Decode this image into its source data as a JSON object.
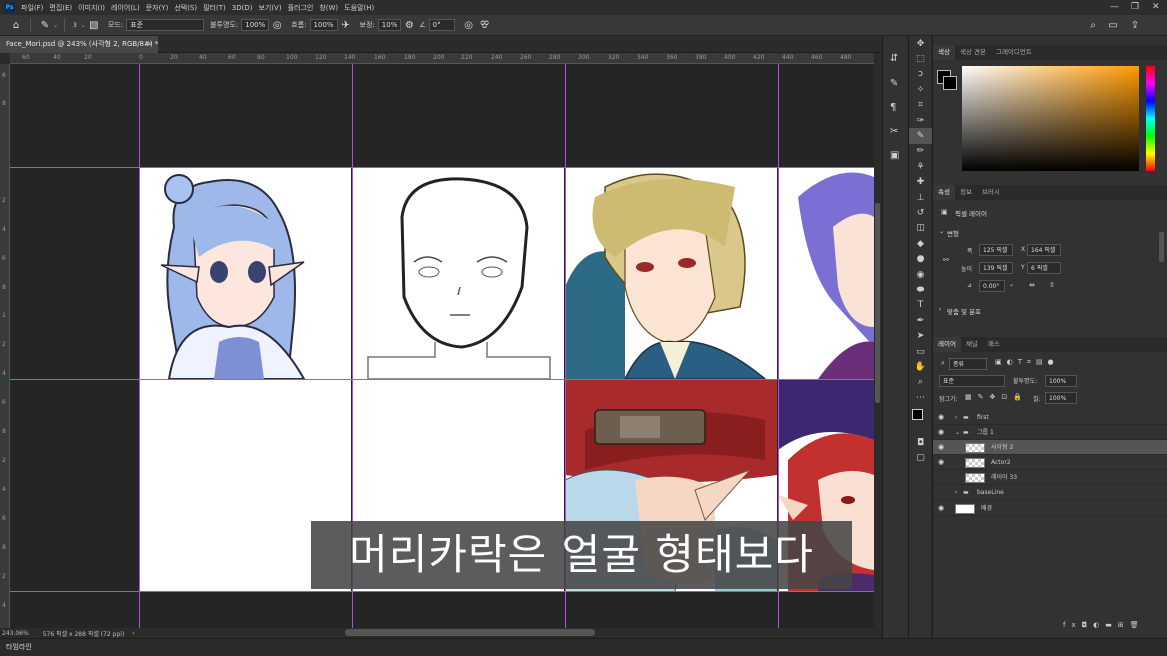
{
  "menubar": {
    "logo": "Ps",
    "items": [
      "파일(F)",
      "편집(E)",
      "이미지(I)",
      "레이어(L)",
      "문자(Y)",
      "선택(S)",
      "필터(T)",
      "3D(D)",
      "보기(V)",
      "플러그인",
      "창(W)",
      "도움말(H)"
    ]
  },
  "options": {
    "brush_size": "3",
    "mode_label": "모드:",
    "mode_value": "표준",
    "opacity_label": "불투명도:",
    "opacity_value": "100%",
    "flow_label": "흐름:",
    "flow_value": "100%",
    "smooth_label": "보정:",
    "smooth_value": "10%",
    "angle_value": "0°"
  },
  "document": {
    "tab_title": "Face_Mori.psd @ 243% (사각형 2, RGB/8#) *",
    "zoom": "243.06%",
    "doc_info": "576 픽셀 x 288 픽셀 (72 ppi)"
  },
  "ruler": {
    "h_ticks": [
      "60",
      "40",
      "20",
      "0",
      "20",
      "40",
      "60",
      "80",
      "100",
      "120",
      "140",
      "160",
      "180",
      "200",
      "220",
      "240",
      "260",
      "280",
      "300",
      "320",
      "340",
      "360",
      "380",
      "400",
      "420",
      "440",
      "460",
      "480"
    ],
    "v_ticks": [
      "6",
      "8",
      "2",
      "4",
      "6",
      "8",
      "1",
      "2",
      "4",
      "6",
      "8",
      "2",
      "4",
      "6",
      "8",
      "2",
      "4",
      "6",
      "8",
      "2"
    ]
  },
  "timeline_label": "타임라인",
  "subtitle": "머리카락은 얼굴 형태보다",
  "panels": {
    "color_tabs": [
      "색상",
      "색상 견본",
      "그레이디언트"
    ],
    "props_tabs": [
      "속성",
      "정보",
      "브러시"
    ],
    "props_title": "픽셀 레이어",
    "transform_label": "변형",
    "w_label": "폭",
    "w_value": "125 픽셀",
    "h_label": "높이",
    "h_value": "139 픽셀",
    "x_label": "X",
    "x_value": "164 픽셀",
    "y_label": "Y",
    "y_value": "6 픽셀",
    "angle_value": "0.00°",
    "align_label": "맞춤 및 분포",
    "layer_tabs": [
      "레이어",
      "채널",
      "패스"
    ],
    "kind_label": "종류",
    "blend_value": "표준",
    "opacity_label": "불투명도:",
    "opacity_value": "100%",
    "lock_label": "잠그기:",
    "fill_label": "칠:",
    "fill_value": "100%",
    "layers": [
      {
        "name": "first"
      },
      {
        "name": "그룹 1"
      },
      {
        "name": "사각형 2"
      },
      {
        "name": "Actor2"
      },
      {
        "name": "레이어 33"
      },
      {
        "name": "baseLine"
      },
      {
        "name": "배경"
      }
    ]
  },
  "colors": {
    "guide": "#b24fd8",
    "accent": "#31a8ff",
    "panel_bg": "#323232"
  }
}
